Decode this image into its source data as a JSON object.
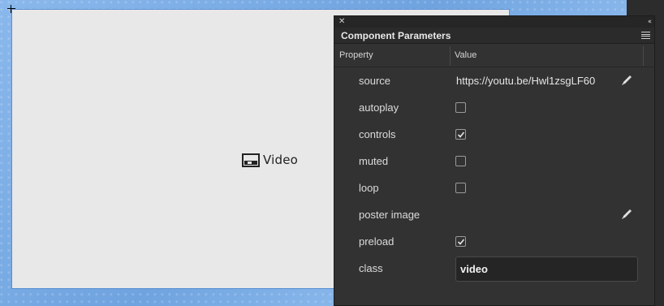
{
  "stage": {
    "placeholder_label": "Video"
  },
  "panel": {
    "title": "Component Parameters",
    "columns": {
      "property": "Property",
      "value": "Value"
    },
    "rows": [
      {
        "label": "source",
        "value": "https://youtu.be/Hwl1zsgLF60"
      },
      {
        "label": "autoplay",
        "checked": false
      },
      {
        "label": "controls",
        "checked": true
      },
      {
        "label": "muted",
        "checked": false
      },
      {
        "label": "loop",
        "checked": false
      },
      {
        "label": "poster image",
        "value": ""
      },
      {
        "label": "preload",
        "checked": true
      },
      {
        "label": "class",
        "value": "video"
      }
    ]
  },
  "icons": {
    "close": "close-icon",
    "collapse": "collapse-panel-icon",
    "menu": "panel-menu-icon",
    "edit": "pencil-icon",
    "video": "video-component-icon"
  }
}
